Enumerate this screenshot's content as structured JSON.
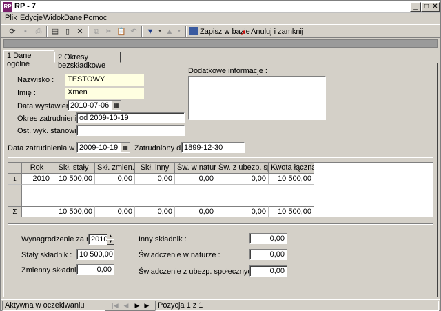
{
  "window": {
    "title": "RP - 7"
  },
  "menu": [
    "Plik",
    "Edycje",
    "Widok",
    "Dane",
    "Pomoc"
  ],
  "toolbar": {
    "save_label": "Zapisz w bazie",
    "cancel_close_label": "Anuluj i zamknij"
  },
  "tabs": [
    "1 Dane ogólne",
    "2 Okresy bezskładkowe"
  ],
  "form": {
    "nazwisko_label": "Nazwisko :",
    "nazwisko_value": "TESTOWY",
    "imie_label": "Imię :",
    "imie_value": "Xmen",
    "data_wyst_label": "Data wystawienia :",
    "data_wyst_value": "2010-07-06",
    "okres_label": "Okres zatrudnienia:",
    "okres_value": "od 2009-10-19",
    "stanowisko_label": "Ost. wyk. stanowisko:",
    "stanowisko_value": "",
    "dodatkowe_label": "Dodatkowe informacje :",
    "data_zatr_label": "Data zatrudnienia w zak. :",
    "data_zatr_value": "2009-10-19",
    "zatr_do_label": "Zatrudniony do:",
    "zatr_do_value": "1899-12-30"
  },
  "grid": {
    "headers": [
      "Rok",
      "Skł. stały",
      "Skł. zmien.",
      "Skł. inny",
      "Św. w naturze",
      "Św. z ubezp. społ.",
      "Kwota łączna"
    ],
    "row": [
      "2010",
      "10 500,00",
      "0,00",
      "0,00",
      "0,00",
      "0,00",
      "10 500,00"
    ],
    "row_indicator": "1",
    "sum_indicator": "Σ",
    "sum": [
      "",
      "10 500,00",
      "0,00",
      "0,00",
      "0,00",
      "0,00",
      "10 500,00"
    ]
  },
  "bottom": {
    "wyn_label": "Wynagrodzenie za rok :",
    "wyn_value": "2010",
    "staly_label": "Stały składnik :",
    "staly_value": "10 500,00",
    "zmienny_label": "Zmienny składnik :",
    "zmienny_value": "0,00",
    "inny_label": "Inny składnik :",
    "inny_value": "0,00",
    "swiad_nat_label": "Świadczenie w naturze :",
    "swiad_nat_value": "0,00",
    "swiad_ubezp_label": "Świadczenie z ubezp. społecznych :",
    "swiad_ubezp_value": "0,00"
  },
  "status": {
    "state": "Aktywna w oczekiwaniu",
    "position": "Pozycja 1 z 1"
  }
}
